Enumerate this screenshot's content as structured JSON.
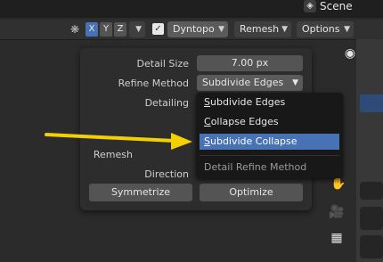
{
  "topbar": {
    "scene_label": "Scene"
  },
  "header": {
    "axes": [
      "X",
      "Y",
      "Z"
    ],
    "dyntopo_label": "Dyntopo",
    "remesh_label": "Remesh",
    "options_label": "Options"
  },
  "popup": {
    "detail_size_label": "Detail Size",
    "detail_size_value": "7.00 px",
    "refine_method_label": "Refine Method",
    "refine_method_value": "Subdivide Edges",
    "detailing_label": "Detailing",
    "remesh_label": "Remesh",
    "direction_label": "Direction",
    "symmetrize_label": "Symmetrize",
    "optimize_label": "Optimize"
  },
  "menu": {
    "items": [
      {
        "first": "S",
        "rest": "ubdivide Edges"
      },
      {
        "first": "C",
        "rest": "ollapse Edges"
      },
      {
        "first": "S",
        "rest": "ubdivide Collapse"
      }
    ],
    "title": "Detail Refine Method",
    "selected_index": 2
  },
  "colors": {
    "accent": "#4772b3",
    "arrow": "#f5d000"
  }
}
